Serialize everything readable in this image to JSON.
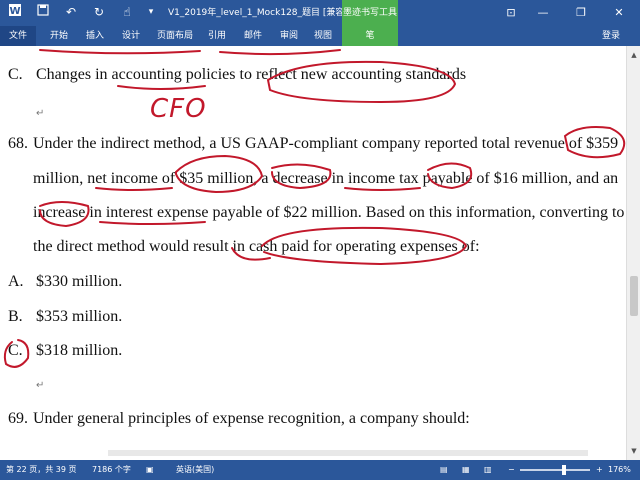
{
  "titlebar": {
    "doc_title": "V1_2019年_level_1_Mock128_题目 [兼容模...",
    "ink_tools_tab": "墨迹书写工具",
    "icons": [
      "word-app-icon",
      "save-icon",
      "undo-icon",
      "redo-icon",
      "touch-mode-icon",
      "customize-qat-icon"
    ]
  },
  "ribbon": {
    "tabs": [
      "文件",
      "开始",
      "插入",
      "设计",
      "页面布局",
      "引用",
      "邮件",
      "审阅",
      "视图",
      "笔"
    ],
    "login": "登录"
  },
  "document": {
    "line_c_prev": {
      "letter": "C.",
      "text": "Changes in accounting policies to reflect new accounting standards"
    },
    "q68": {
      "number": "68.",
      "lines": [
        "Under the indirect method, a US GAAP-compliant company reported total revenue of $359",
        "million, net income of $35 million, a decrease in income tax payable of $16 million, and an",
        "increase in interest expense payable of $22 million. Based on this information, converting to",
        "the direct method would result in cash paid for operating expenses of:"
      ],
      "options": [
        {
          "letter": "A.",
          "text": "$330 million."
        },
        {
          "letter": "B.",
          "text": "$353 million."
        },
        {
          "letter": "C.",
          "text": "$318 million."
        }
      ]
    },
    "q69": {
      "number": "69.",
      "text": "Under general principles of expense recognition, a company should:"
    },
    "handwriting": "CFO",
    "para_mark": "↵"
  },
  "statusbar": {
    "page": "第 22 页，共 39 页",
    "words": "7186 个字",
    "language": "英语(美国)",
    "zoom": "176%",
    "zoom_minus": "−",
    "zoom_plus": "+"
  },
  "colors": {
    "word_blue": "#2b579a",
    "ink_red": "#c2182b",
    "pen_green": "#4caf4f"
  }
}
